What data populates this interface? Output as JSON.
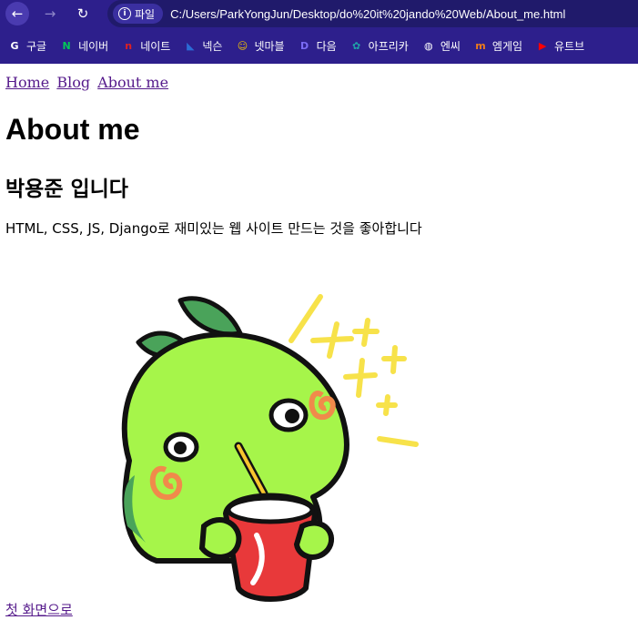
{
  "browser": {
    "site_chip_label": "파일",
    "url": "C:/Users/ParkYongJun/Desktop/do%20it%20jando%20Web/About_me.html",
    "bookmarks": [
      {
        "label": "구글",
        "icon": "google-icon",
        "color": "#ffffff",
        "glyph": "G"
      },
      {
        "label": "네이버",
        "icon": "naver-icon",
        "color": "#03c75a",
        "glyph": "N"
      },
      {
        "label": "네이트",
        "icon": "nate-icon",
        "color": "#e02020",
        "glyph": "n"
      },
      {
        "label": "넥슨",
        "icon": "nexon-icon",
        "color": "#2b6cd6",
        "glyph": "◣"
      },
      {
        "label": "넷마블",
        "icon": "netmarble-icon",
        "color": "#f5c400",
        "glyph": "☺"
      },
      {
        "label": "다음",
        "icon": "daum-icon",
        "color": "#7b6cf6",
        "glyph": "D"
      },
      {
        "label": "아프리카",
        "icon": "afreeca-icon",
        "color": "#1fa3a8",
        "glyph": "✿"
      },
      {
        "label": "엔씨",
        "icon": "globe-icon",
        "color": "#ffffff",
        "glyph": "◍"
      },
      {
        "label": "엠게임",
        "icon": "mgame-icon",
        "color": "#f07c1a",
        "glyph": "m"
      },
      {
        "label": "유트브",
        "icon": "youtube-icon",
        "color": "#ff0000",
        "glyph": "▶"
      }
    ]
  },
  "page": {
    "nav": [
      "Home",
      "Blog",
      "About me"
    ],
    "title": "About me",
    "subtitle": "박용준 입니다",
    "intro": "HTML, CSS, JS, Django로 재미있는 웹 사이트 만드는 것을 좋아합니다",
    "back_link": "첫 화면으로"
  },
  "colors": {
    "chrome": "#2d1f8c",
    "visited_link": "#551a8b",
    "mascot_body": "#a6f54a",
    "mascot_leaf": "#4aa35a",
    "cheek": "#f08a4b",
    "cup": "#e8393a",
    "sparkle": "#f7e24a"
  }
}
